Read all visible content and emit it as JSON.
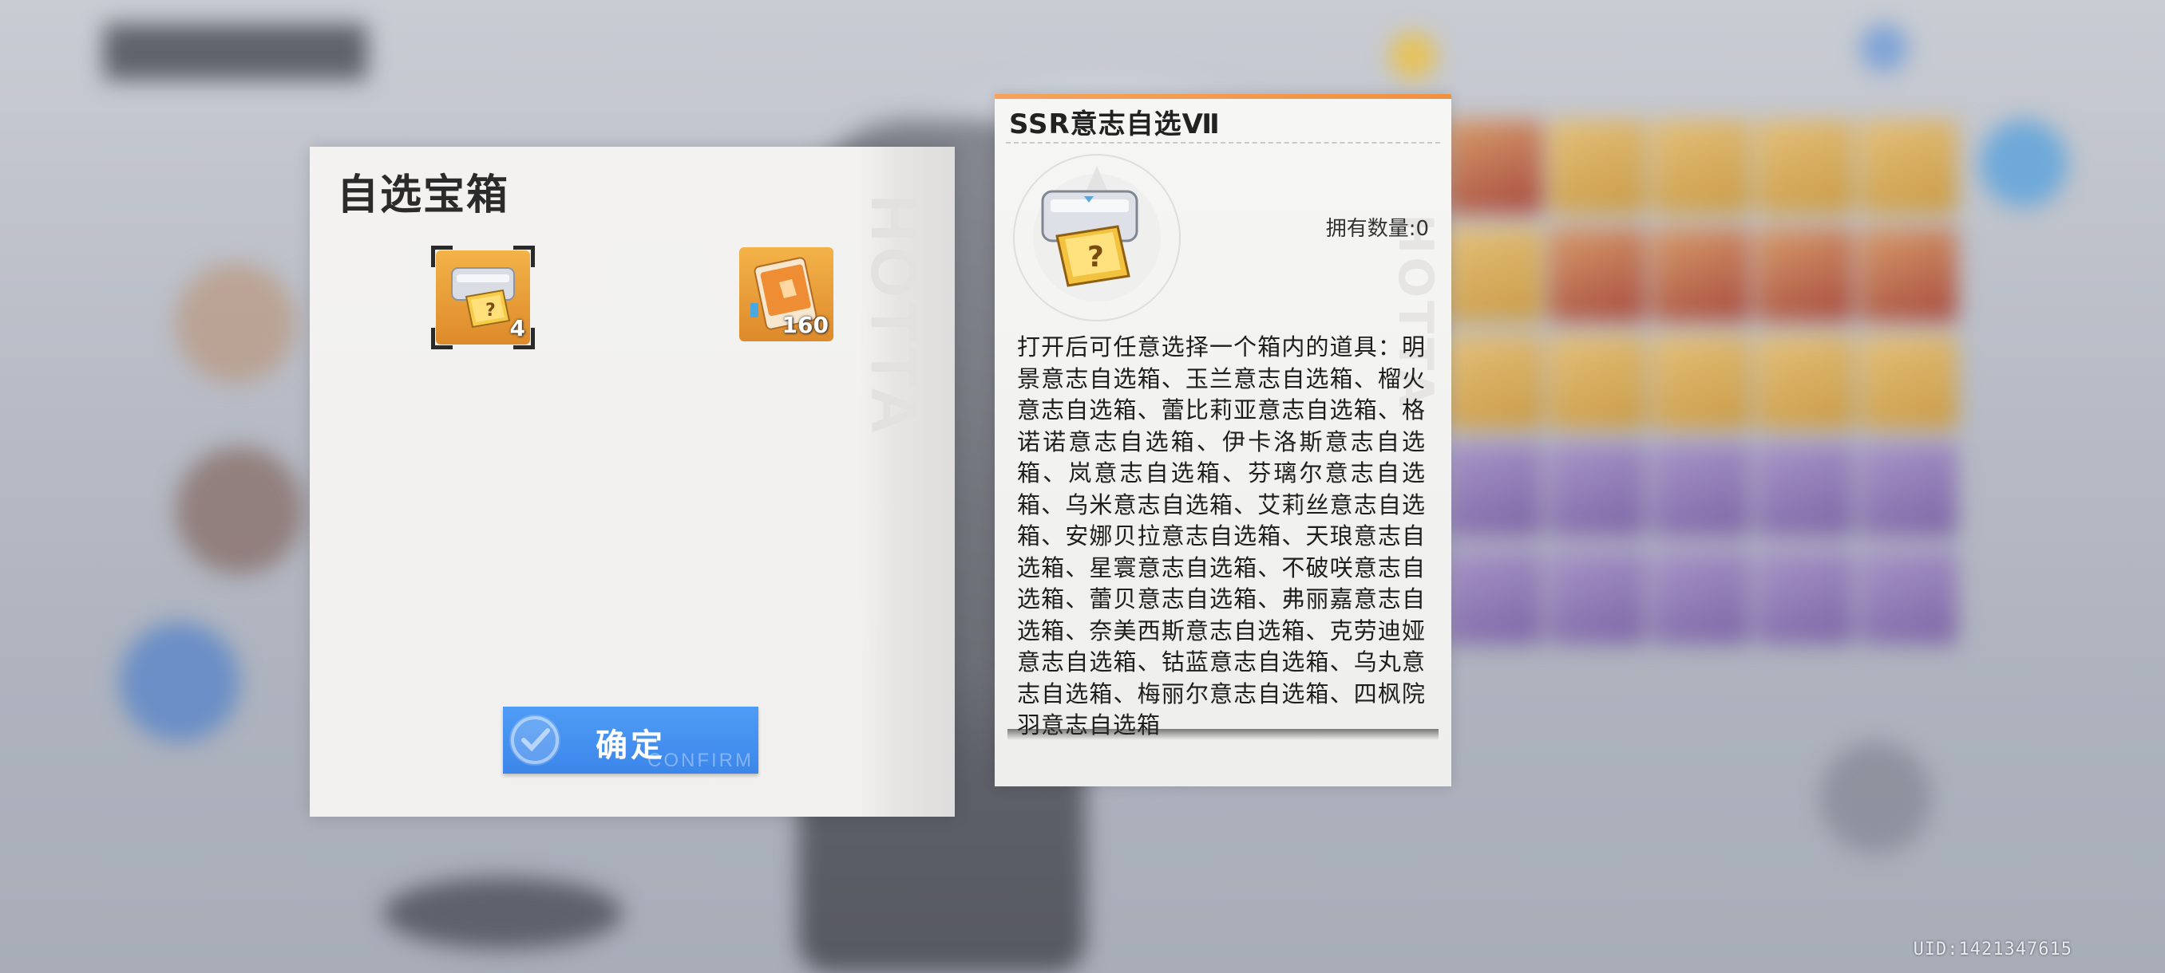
{
  "chest_dialog": {
    "title": "自选宝箱",
    "watermark": "HOTTA",
    "items": [
      {
        "icon": "ssr-will-selection-box-icon",
        "count": "4",
        "selected": true
      },
      {
        "icon": "gold-voucher-card-icon",
        "count": "160",
        "selected": false
      }
    ],
    "confirm_label": "确定",
    "confirm_sub": "CONFIRM"
  },
  "detail_panel": {
    "title": "SSR意志自选Ⅶ",
    "icon": "ssr-will-selection-box-icon",
    "owned_label": "拥有数量:0",
    "watermark": "HOTTA",
    "description": "打开后可任意选择一个箱内的道具：明景意志自选箱、玉兰意志自选箱、榴火意志自选箱、蕾比莉亚意志自选箱、格诺诺意志自选箱、伊卡洛斯意志自选箱、岚意志自选箱、芬璃尔意志自选箱、乌米意志自选箱、艾莉丝意志自选箱、安娜贝拉意志自选箱、天琅意志自选箱、星寰意志自选箱、不破咲意志自选箱、蕾贝意志自选箱、弗丽嘉意志自选箱、奈美西斯意志自选箱、克劳迪娅意志自选箱、钴蓝意志自选箱、乌丸意志自选箱、梅丽尔意志自选箱、四枫院羽意志自选箱"
  },
  "footer": {
    "uid": "UID:1421347615"
  },
  "colors": {
    "confirm_blue": "#3f8bed",
    "accent_orange": "#f29040",
    "item_gold": "#e8992f"
  }
}
